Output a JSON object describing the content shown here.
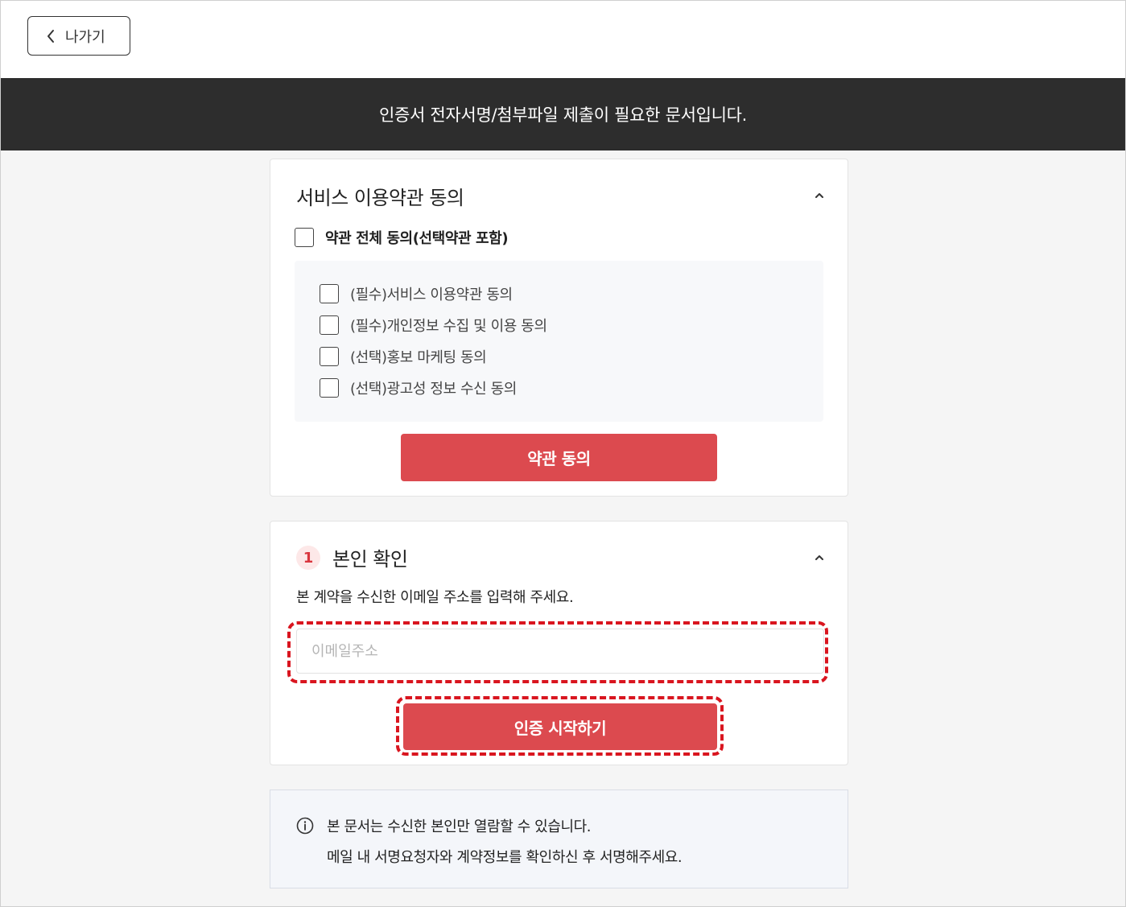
{
  "nav": {
    "back_label": "나가기"
  },
  "banner": {
    "text": "인증서 전자서명/첨부파일 제출이 필요한 문서입니다."
  },
  "terms": {
    "title": "서비스 이용약관 동의",
    "all_agree_label": "약관 전체 동의(선택약관 포함)",
    "items": [
      {
        "label": "(필수)서비스 이용약관 동의",
        "checked": false
      },
      {
        "label": "(필수)개인정보 수집 및 이용 동의",
        "checked": false
      },
      {
        "label": "(선택)홍보 마케팅 동의",
        "checked": false
      },
      {
        "label": "(선택)광고성 정보 수신 동의",
        "checked": false
      }
    ],
    "agree_button": "약관 동의"
  },
  "verify": {
    "step": "1",
    "title": "본인 확인",
    "description": "본 계약을 수신한 이메일 주소를 입력해 주세요.",
    "email_placeholder": "이메일주소",
    "email_value": "",
    "start_button": "인증 시작하기"
  },
  "notice": {
    "lines": [
      "본 문서는 수신한 본인만 열람할 수 있습니다.",
      "메일 내 서명요청자와 계약정보를 확인하신 후 서명해주세요."
    ]
  },
  "colors": {
    "accent": "#dc4a4f",
    "banner_bg": "#2d2d2d",
    "highlight": "#d9151f"
  }
}
